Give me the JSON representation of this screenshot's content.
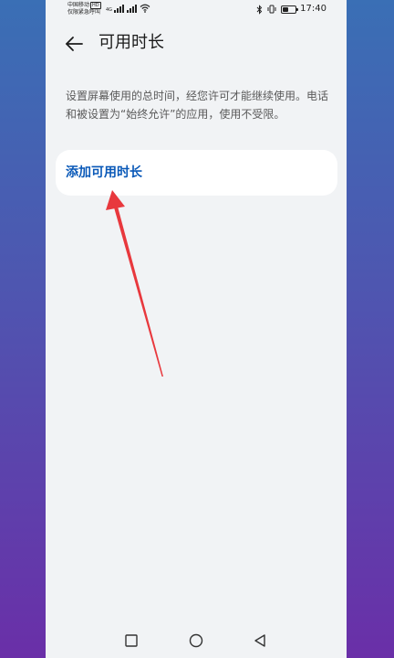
{
  "status_bar": {
    "carrier_line1": "中国移动",
    "carrier_badge": "HD",
    "carrier_line2": "仅限紧急呼叫",
    "network_tag": "4G",
    "time": "17:40"
  },
  "header": {
    "title": "可用时长"
  },
  "description": "设置屏幕使用的总时间，经您许可才能继续使用。电话和被设置为“始终允许”的应用，使用不受限。",
  "card": {
    "label": "添加可用时长"
  },
  "annotation": {
    "arrow_color": "#e8383d"
  },
  "colors": {
    "accent": "#0a59b8",
    "background": "#f1f3f5"
  }
}
